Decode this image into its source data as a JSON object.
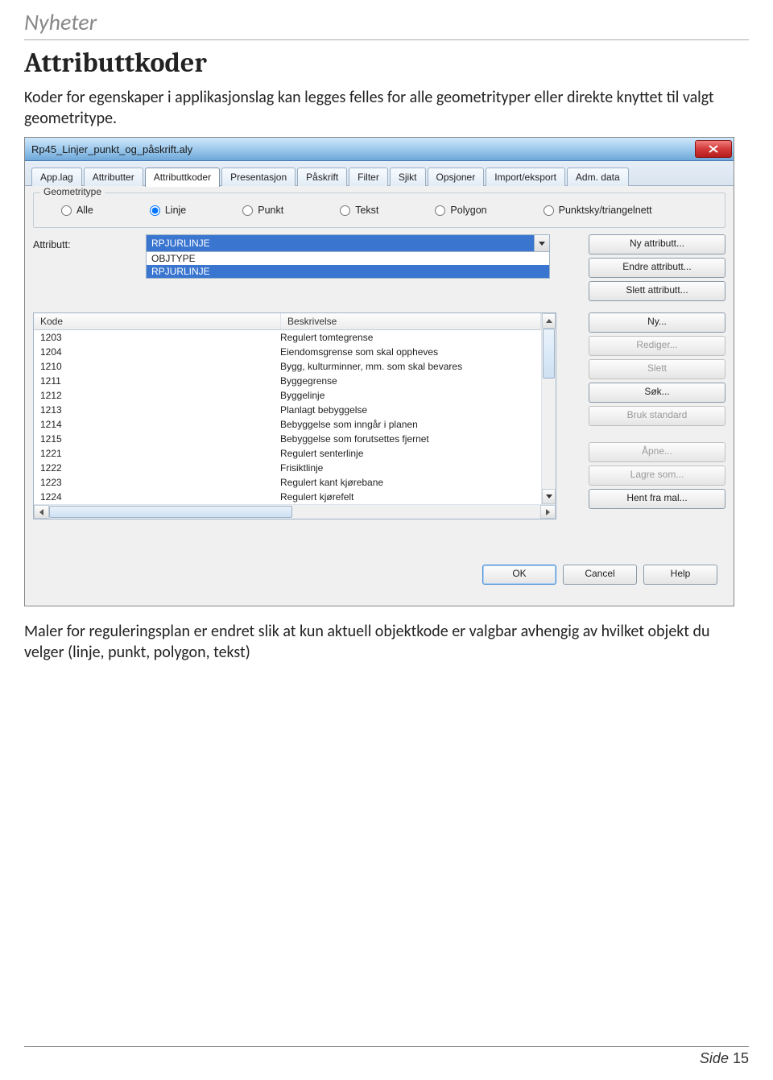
{
  "page_header": "Nyheter",
  "heading": "Attributtkoder",
  "intro": "Koder for egenskaper i applikasjonslag kan legges felles for alle geometrityper eller direkte knyttet til valgt geometritype.",
  "window": {
    "title": "Rp45_Linjer_punkt_og_påskrift.aly",
    "tabs": [
      "App.lag",
      "Attributter",
      "Attributtkoder",
      "Presentasjon",
      "Påskrift",
      "Filter",
      "Sjikt",
      "Opsjoner",
      "Import/eksport",
      "Adm. data"
    ],
    "active_tab": 2,
    "group_legend": "Geometritype",
    "radios": [
      {
        "label": "Alle",
        "checked": false
      },
      {
        "label": "Linje",
        "checked": true
      },
      {
        "label": "Punkt",
        "checked": false
      },
      {
        "label": "Tekst",
        "checked": false
      },
      {
        "label": "Polygon",
        "checked": false
      },
      {
        "label": "Punktsky/triangelnett",
        "checked": false
      }
    ],
    "attr_label": "Attributt:",
    "combo_selected": "RPJURLINJE",
    "combo_items": [
      {
        "text": "OBJTYPE",
        "hl": false
      },
      {
        "text": "RPJURLINJE",
        "hl": true
      }
    ],
    "attr_buttons": [
      "Ny attributt...",
      "Endre attributt...",
      "Slett attributt..."
    ],
    "table": {
      "headers": [
        "Kode",
        "Beskrivelse"
      ],
      "rows": [
        {
          "k": "1203",
          "b": "Regulert tomtegrense"
        },
        {
          "k": "1204",
          "b": "Eiendomsgrense som skal oppheves"
        },
        {
          "k": "1210",
          "b": "Bygg, kulturminner, mm. som skal bevares"
        },
        {
          "k": "1211",
          "b": "Byggegrense"
        },
        {
          "k": "1212",
          "b": "Byggelinje"
        },
        {
          "k": "1213",
          "b": "Planlagt bebyggelse"
        },
        {
          "k": "1214",
          "b": "Bebyggelse som inngår i planen"
        },
        {
          "k": "1215",
          "b": "Bebyggelse som forutsettes fjernet"
        },
        {
          "k": "1221",
          "b": "Regulert senterlinje"
        },
        {
          "k": "1222",
          "b": "Frisiktlinje"
        },
        {
          "k": "1223",
          "b": "Regulert kant kjørebane"
        },
        {
          "k": "1224",
          "b": "Regulert kjørefelt"
        }
      ]
    },
    "side_buttons": [
      {
        "label": "Ny...",
        "enabled": true
      },
      {
        "label": "Rediger...",
        "enabled": false
      },
      {
        "label": "Slett",
        "enabled": false
      },
      {
        "label": "Søk...",
        "enabled": true
      },
      {
        "label": "Bruk standard",
        "enabled": false
      },
      {
        "label": "Åpne...",
        "enabled": false
      },
      {
        "label": "Lagre som...",
        "enabled": false
      },
      {
        "label": "Hent fra mal...",
        "enabled": true
      }
    ],
    "dialog_buttons": [
      "OK",
      "Cancel",
      "Help"
    ]
  },
  "outro": "Maler for reguleringsplan er endret slik at kun aktuell objektkode er valgbar avhengig av hvilket objekt du velger (linje, punkt, polygon, tekst)",
  "footer": {
    "side": "Side",
    "num": "15"
  }
}
